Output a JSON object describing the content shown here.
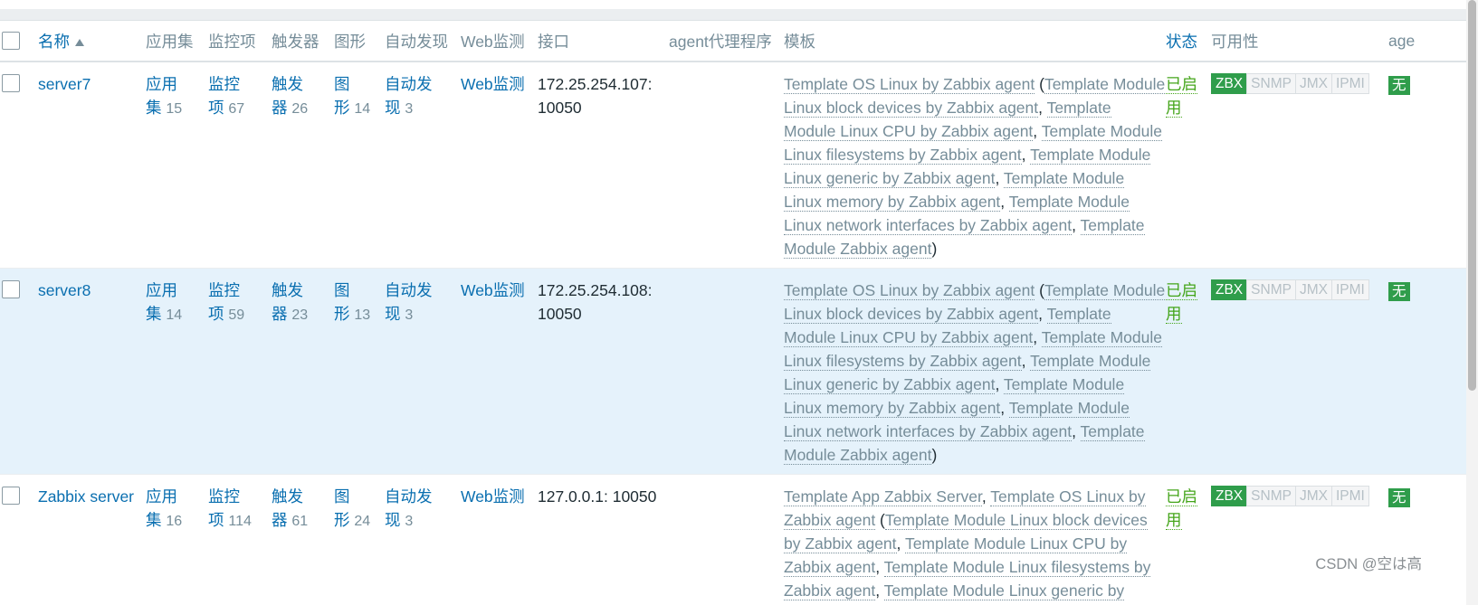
{
  "header": {
    "name": "名称",
    "apps": "应用集",
    "items": "监控项",
    "triggers": "触发器",
    "graphs": "图形",
    "discovery": "自动发现",
    "web": "Web监测",
    "interface": "接口",
    "proxy": "agent代理程序",
    "templates": "模板",
    "status": "状态",
    "availability": "可用性",
    "encryption": "age"
  },
  "rows": [
    {
      "name": "server7",
      "apps_label_a": "应用",
      "apps_label_b": "集",
      "apps_count": "15",
      "items_label_a": "监控",
      "items_label_b": "项",
      "items_count": "67",
      "triggers_label_a": "触发",
      "triggers_label_b": "器",
      "triggers_count": "26",
      "graphs_label_a": "图",
      "graphs_label_b": "形",
      "graphs_count": "14",
      "disc_label_a": "自动发",
      "disc_label_b": "现",
      "disc_count": "3",
      "web": "Web监测",
      "iface_a": "172.25.254.107:",
      "iface_b": "10050",
      "templates": {
        "pre": "Template OS Linux by Zabbix agent",
        "children": [
          "Template Module Linux block devices by Zabbix agent",
          "Template Module Linux CPU by Zabbix agent",
          "Template Module Linux filesystems by Zabbix agent",
          "Template Module Linux generic by Zabbix agent",
          "Template Module Linux memory by Zabbix agent",
          "Template Module Linux network interfaces by Zabbix agent",
          "Template Module Zabbix agent"
        ]
      },
      "status_a": "已启",
      "status_b": "用",
      "badges": [
        "ZBX",
        "SNMP",
        "JMX",
        "IPMI"
      ],
      "enc": "无"
    },
    {
      "name": "server8",
      "apps_label_a": "应用",
      "apps_label_b": "集",
      "apps_count": "14",
      "items_label_a": "监控",
      "items_label_b": "项",
      "items_count": "59",
      "triggers_label_a": "触发",
      "triggers_label_b": "器",
      "triggers_count": "23",
      "graphs_label_a": "图",
      "graphs_label_b": "形",
      "graphs_count": "13",
      "disc_label_a": "自动发",
      "disc_label_b": "现",
      "disc_count": "3",
      "web": "Web监测",
      "iface_a": "172.25.254.108:",
      "iface_b": "10050",
      "templates": {
        "pre": "Template OS Linux by Zabbix agent",
        "children": [
          "Template Module Linux block devices by Zabbix agent",
          "Template Module Linux CPU by Zabbix agent",
          "Template Module Linux filesystems by Zabbix agent",
          "Template Module Linux generic by Zabbix agent",
          "Template Module Linux memory by Zabbix agent",
          "Template Module Linux network interfaces by Zabbix agent",
          "Template Module Zabbix agent"
        ]
      },
      "status_a": "已启",
      "status_b": "用",
      "badges": [
        "ZBX",
        "SNMP",
        "JMX",
        "IPMI"
      ],
      "enc": "无"
    },
    {
      "name": "Zabbix server",
      "apps_label_a": "应用",
      "apps_label_b": "集",
      "apps_count": "16",
      "items_label_a": "监控",
      "items_label_b": "项",
      "items_count": "114",
      "triggers_label_a": "触发",
      "triggers_label_b": "器",
      "triggers_count": "61",
      "graphs_label_a": "图",
      "graphs_label_b": "形",
      "graphs_count": "24",
      "disc_label_a": "自动发",
      "disc_label_b": "现",
      "disc_count": "3",
      "web": "Web监测",
      "iface_a": "127.0.0.1: 10050",
      "iface_b": "",
      "templates": {
        "first": "Template App Zabbix Server",
        "pre": "Template OS Linux by Zabbix agent",
        "children": [
          "Template Module Linux block devices by Zabbix agent",
          "Template Module Linux CPU by Zabbix agent",
          "Template Module Linux filesystems by Zabbix agent",
          "Template Module Linux generic by Zabbix agent"
        ]
      },
      "status_a": "已启",
      "status_b": "用",
      "badges": [
        "ZBX",
        "SNMP",
        "JMX",
        "IPMI"
      ],
      "enc": "无"
    }
  ],
  "watermark": "CSDN @空は高"
}
